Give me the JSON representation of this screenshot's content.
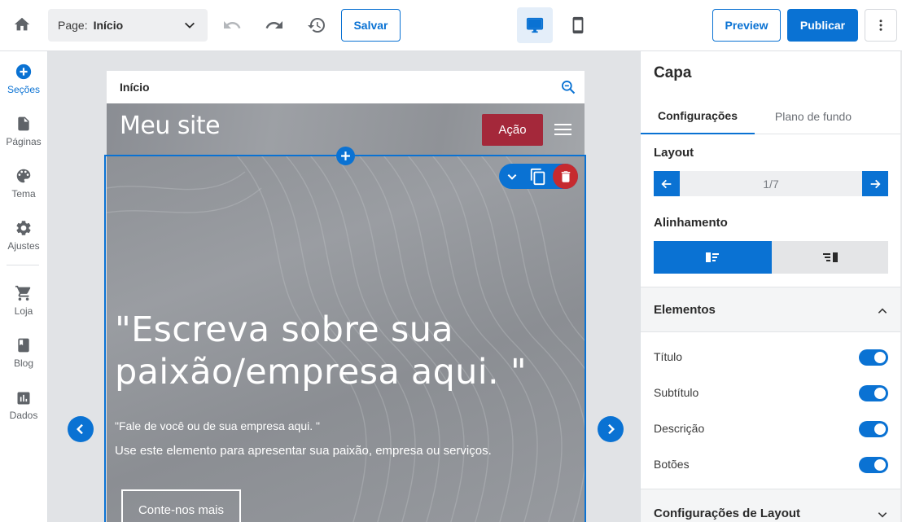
{
  "toolbar": {
    "page_label": "Page:",
    "page_value": "Início",
    "save_label": "Salvar",
    "preview_label": "Preview",
    "publish_label": "Publicar",
    "icons": [
      "home-icon",
      "chevron-down-icon",
      "undo-icon",
      "redo-icon",
      "history-icon",
      "desktop-icon",
      "mobile-icon",
      "more-vertical-icon"
    ]
  },
  "sidebar": {
    "items": [
      {
        "label": "Seções",
        "icon": "add-circle-icon",
        "active": true
      },
      {
        "label": "Páginas",
        "icon": "page-icon",
        "active": false
      },
      {
        "label": "Tema",
        "icon": "palette-icon",
        "active": false
      },
      {
        "label": "Ajustes",
        "icon": "gear-icon",
        "active": false
      },
      {
        "label": "Loja",
        "icon": "cart-icon",
        "active": false
      },
      {
        "label": "Blog",
        "icon": "book-icon",
        "active": false
      },
      {
        "label": "Dados",
        "icon": "bar-chart-icon",
        "active": false
      }
    ]
  },
  "canvas": {
    "frame_title": "Início",
    "site_title": "Meu site",
    "action_label": "Ação",
    "hero_title": "\"Escreva sobre sua paixão/empresa aqui. \"",
    "hero_subtitle": "\"Fale de você ou de sua empresa aqui. \"",
    "hero_description": "Use este elemento para apresentar sua paixão, empresa ou serviços.",
    "hero_button": "Conte-nos mais"
  },
  "panel": {
    "title": "Capa",
    "tabs": [
      "Configurações",
      "Plano de fundo"
    ],
    "active_tab": "Configurações",
    "layout_label": "Layout",
    "layout_value": "1/7",
    "alignment_label": "Alinhamento",
    "alignment_selected": "left",
    "elements_label": "Elementos",
    "toggles": [
      {
        "label": "Título",
        "on": true
      },
      {
        "label": "Subtítulo",
        "on": true
      },
      {
        "label": "Descrição",
        "on": true
      },
      {
        "label": "Botões",
        "on": true
      }
    ],
    "layout_settings_label": "Configurações de Layout"
  },
  "colors": {
    "accent": "#0a72d3",
    "action_button": "#a4283a",
    "delete": "#c62a2f"
  }
}
